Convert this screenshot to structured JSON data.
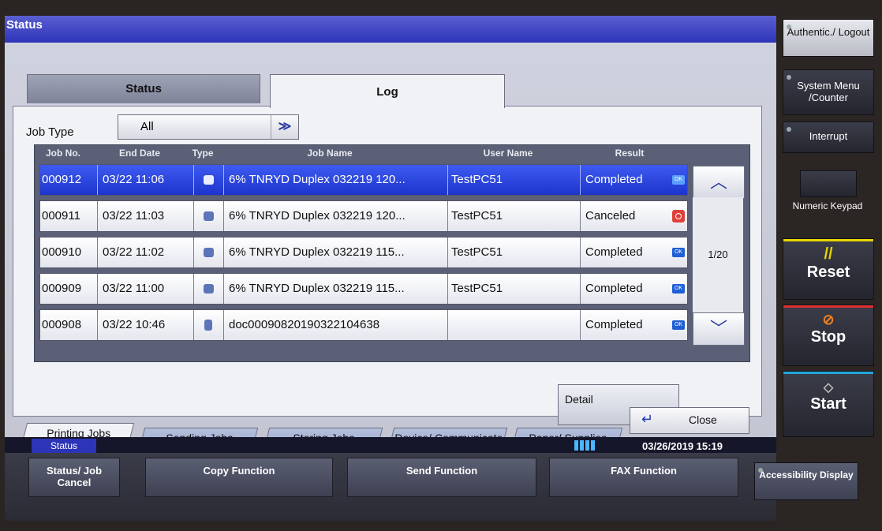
{
  "window": {
    "title": "Status"
  },
  "tabs": {
    "status": "Status",
    "log": "Log"
  },
  "job_type": {
    "label": "Job Type",
    "value": "All",
    "arrow": "≫"
  },
  "table": {
    "headers": {
      "job_no": "Job No.",
      "end_date": "End Date",
      "type": "Type",
      "job_name": "Job Name",
      "user_name": "User Name",
      "result": "Result"
    },
    "rows": [
      {
        "job_no": "000912",
        "end_date": "03/22 11:06",
        "job_name": "6% TNRYD Duplex 032219 120...",
        "user_name": "TestPC51",
        "result": "Completed"
      },
      {
        "job_no": "000911",
        "end_date": "03/22 11:03",
        "job_name": "6% TNRYD Duplex 032219 120...",
        "user_name": "TestPC51",
        "result": "Canceled"
      },
      {
        "job_no": "000910",
        "end_date": "03/22 11:02",
        "job_name": "6% TNRYD Duplex 032219 115...",
        "user_name": "TestPC51",
        "result": "Completed"
      },
      {
        "job_no": "000909",
        "end_date": "03/22 11:00",
        "job_name": "6% TNRYD Duplex 032219 115...",
        "user_name": "TestPC51",
        "result": "Completed"
      },
      {
        "job_no": "000908",
        "end_date": "03/22 10:46",
        "job_name": "doc00090820190322104638",
        "user_name": "",
        "result": "Completed"
      }
    ],
    "page": "1/20",
    "ok_icon_text": "OK"
  },
  "detail_button": "Detail",
  "bottom_tabs": {
    "printing": "Printing Jobs",
    "sending": "Sending Jobs",
    "storing": "Storing Jobs",
    "device": "Device/ Communicate",
    "paper": "Paper/ Supplies"
  },
  "close_button": "Close",
  "status_tag": "Status",
  "datetime": "03/26/2019  15:19",
  "function_buttons": {
    "status_cancel": "Status/ Job Cancel",
    "copy": "Copy Function",
    "send": "Send Function",
    "fax": "FAX Function",
    "accessibility": "Accessibility Display"
  },
  "hardware_keys": {
    "auth": "Authentic./ Logout",
    "system_menu": "System Menu /Counter",
    "interrupt": "Interrupt",
    "numeric": "Numeric Keypad",
    "reset": "Reset",
    "stop": "Stop",
    "start": "Start"
  },
  "colors": {
    "selection": "#2a45e0",
    "title": "#2d34b8",
    "reset_accent": "#e8d400",
    "stop_accent": "#e03030",
    "start_accent": "#20a8d8"
  }
}
